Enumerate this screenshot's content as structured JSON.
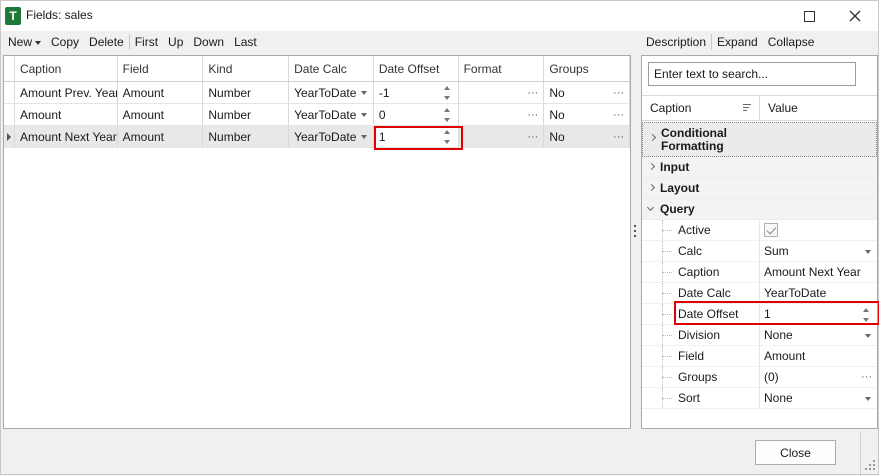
{
  "window": {
    "title": "Fields: sales",
    "app_icon_letter": "T",
    "app_icon_color": "#1f7a3a"
  },
  "toolbar": {
    "new_label": "New",
    "copy_label": "Copy",
    "delete_label": "Delete",
    "first_label": "First",
    "up_label": "Up",
    "down_label": "Down",
    "last_label": "Last"
  },
  "panel_toolbar": {
    "description_label": "Description",
    "expand_label": "Expand",
    "collapse_label": "Collapse"
  },
  "grid": {
    "columns": [
      "Caption",
      "Field",
      "Kind",
      "Date Calc",
      "Date Offset",
      "Format",
      "Groups"
    ],
    "rows": [
      {
        "caption": "Amount Prev. Year",
        "field": "Amount",
        "kind": "Number",
        "date_calc": "YearToDate",
        "date_offset": "-1",
        "format": "",
        "groups": "No"
      },
      {
        "caption": "Amount",
        "field": "Amount",
        "kind": "Number",
        "date_calc": "YearToDate",
        "date_offset": "0",
        "format": "",
        "groups": "No"
      },
      {
        "caption": "Amount Next Year",
        "field": "Amount",
        "kind": "Number",
        "date_calc": "YearToDate",
        "date_offset": "1",
        "format": "",
        "groups": "No"
      }
    ],
    "selected_row": 2,
    "ellipsis_glyph": "···"
  },
  "properties": {
    "search_placeholder": "Enter text to search...",
    "header_caption": "Caption",
    "header_value": "Value",
    "categories": {
      "conditional_formatting": "Conditional Formatting",
      "input": "Input",
      "layout": "Layout",
      "query": "Query"
    },
    "query_items": [
      {
        "name": "Active",
        "value": ""
      },
      {
        "name": "Calc",
        "value": "Sum"
      },
      {
        "name": "Caption",
        "value": "Amount Next Year"
      },
      {
        "name": "Date Calc",
        "value": "YearToDate"
      },
      {
        "name": "Date Offset",
        "value": "1"
      },
      {
        "name": "Division",
        "value": "None"
      },
      {
        "name": "Field",
        "value": "Amount"
      },
      {
        "name": "Groups",
        "value": "(0)"
      },
      {
        "name": "Sort",
        "value": "None"
      }
    ]
  },
  "footer": {
    "close_label": "Close"
  },
  "colors": {
    "highlight": "#e00000",
    "selected_row": "#e8e8e8"
  }
}
